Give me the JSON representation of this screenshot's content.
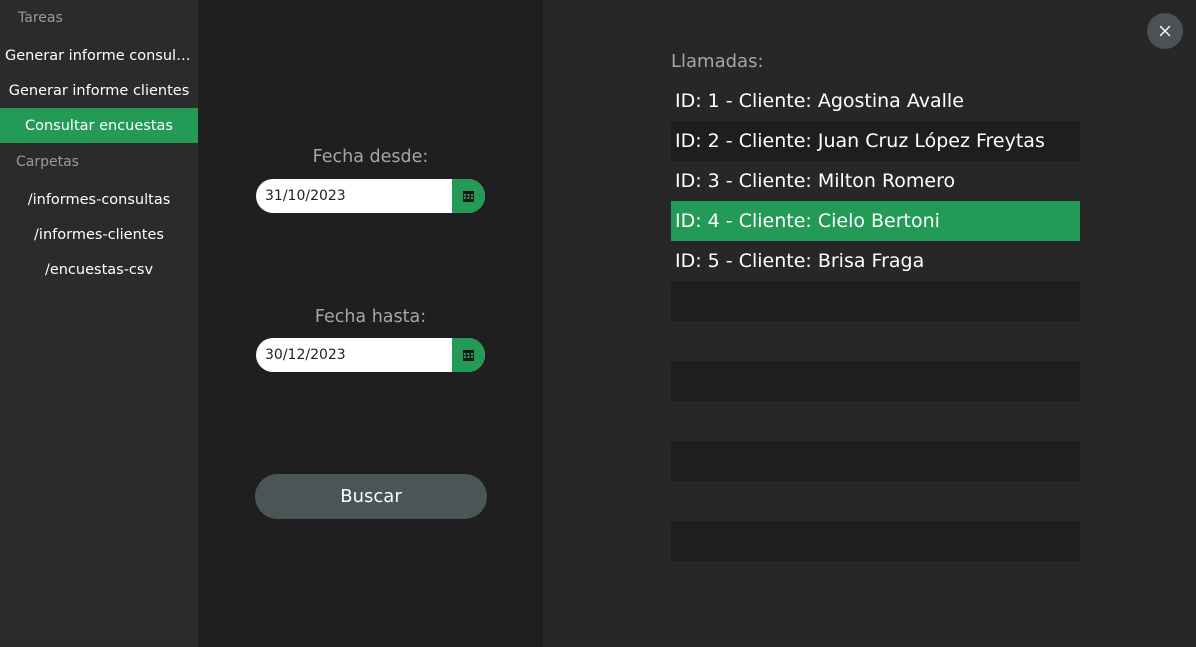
{
  "sidebar": {
    "tasks_header": "Tareas",
    "tasks": [
      {
        "label": "Generar informe consultas"
      },
      {
        "label": "Generar informe clientes"
      },
      {
        "label": "Consultar encuestas"
      }
    ],
    "active_task": "Consultar encuestas",
    "folders_header": "Carpetas",
    "folders": [
      {
        "label": "/informes-consultas"
      },
      {
        "label": "/informes-clientes"
      },
      {
        "label": "/encuestas-csv"
      }
    ]
  },
  "form": {
    "from_label": "Fecha desde:",
    "from_value": "31/10/2023",
    "to_label": "Fecha hasta:",
    "to_value": "30/12/2023",
    "search_label": "Buscar"
  },
  "calls": {
    "title": "Llamadas:",
    "rows": [
      {
        "text": "ID: 1 - Cliente: Agostina Avalle"
      },
      {
        "text": "ID: 2 - Cliente: Juan Cruz López Freytas"
      },
      {
        "text": "ID: 3 - Cliente: Milton Romero"
      },
      {
        "text": "ID: 4 - Cliente: Cielo Bertoni"
      },
      {
        "text": "ID: 5 - Cliente: Brisa Fraga"
      },
      {
        "text": ""
      },
      {
        "text": ""
      },
      {
        "text": ""
      },
      {
        "text": ""
      },
      {
        "text": ""
      },
      {
        "text": ""
      },
      {
        "text": ""
      }
    ],
    "selected_row": "ID: 4 - Cliente: Cielo Bertoni"
  },
  "icons": {
    "calendar": "calendar-icon",
    "close": "close-icon"
  },
  "colors": {
    "accent": "#239b56",
    "sidebar_bg": "#2b2b2b",
    "form_bg": "#1f1f1f",
    "main_bg": "#272727",
    "button_bg": "#4b5557"
  }
}
